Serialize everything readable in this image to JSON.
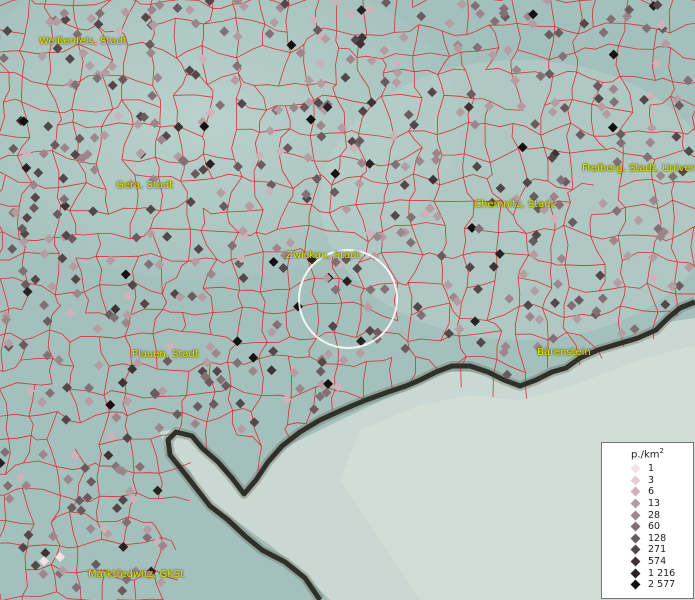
{
  "map": {
    "cities": [
      {
        "name": "Weißenfels, Stadt",
        "label": "Weißenfels, Stadt"
      },
      {
        "name": "Gera, Stadt",
        "label": "Gera, Stadt"
      },
      {
        "name": "Zwickau, Stadt",
        "label": "Zwickau, Stadt"
      },
      {
        "name": "Chemnitz, Stadt",
        "label": "Chemnitz, Stadt"
      },
      {
        "name": "Freiberg, Stadt, Univers",
        "label": "Freiberg, Stadt, Univers"
      },
      {
        "name": "Plauen, Stadt",
        "label": "Plauen, Stadt"
      },
      {
        "name": "Bärenstein",
        "label": "Bärenstein"
      },
      {
        "name": "Marktredwitz, GKSt",
        "label": "Marktredwitz, GKSt"
      }
    ],
    "colors": {
      "boundary": "#e02020",
      "label": "#e8e600",
      "terrain": "#a9c4c0",
      "focus_ring": "#ffffff",
      "country_border": "#111111"
    }
  },
  "legend": {
    "title": "p./km",
    "title_sup": "2",
    "entries": [
      {
        "label": "1",
        "color": "#f4e2e6"
      },
      {
        "label": "3",
        "color": "#e3cdd2"
      },
      {
        "label": "6",
        "color": "#cdb3b9"
      },
      {
        "label": "13",
        "color": "#b59ca2"
      },
      {
        "label": "28",
        "color": "#9c868b"
      },
      {
        "label": "60",
        "color": "#837075"
      },
      {
        "label": "128",
        "color": "#6b5b5f"
      },
      {
        "label": "271",
        "color": "#54474a"
      },
      {
        "label": "574",
        "color": "#3e3436"
      },
      {
        "label": "1 216",
        "color": "#282224"
      },
      {
        "label": "2 577",
        "color": "#141012"
      }
    ]
  }
}
